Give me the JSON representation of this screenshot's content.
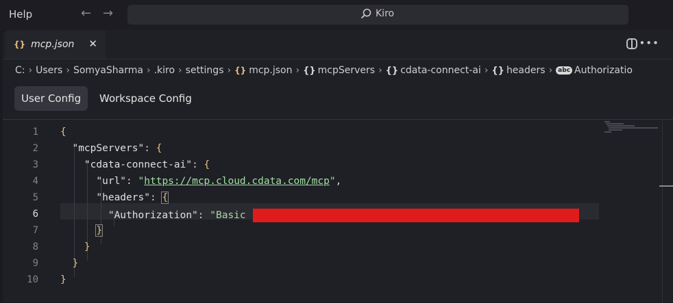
{
  "titlebar": {
    "menu_help": "Help",
    "back_icon": "arrow-left-icon",
    "forward_icon": "arrow-right-icon",
    "search_text": "Kiro"
  },
  "tabs": [
    {
      "label": "mcp.json",
      "icon": "{}",
      "close": "✕"
    }
  ],
  "breadcrumb": {
    "drive": "C:",
    "parts": [
      "Users",
      "SomyaSharma",
      ".kiro",
      "settings"
    ],
    "file": "mcp.json",
    "file_icon": "{}",
    "obj_icon": "{}",
    "symbols": [
      "mcpServers",
      "cdata-connect-ai",
      "headers"
    ],
    "string_icon": "abc",
    "last": "Authorizatio"
  },
  "config": {
    "user_config": "User Config",
    "workspace_config": "Workspace Config"
  },
  "editor": {
    "line_numbers": [
      "1",
      "2",
      "3",
      "4",
      "5",
      "6",
      "7",
      "8",
      "9",
      "10"
    ],
    "lines": {
      "l1_brace": "{",
      "l2_key": "\"mcpServers\"",
      "l2_rest": ": ",
      "l2_brace": "{",
      "l3_key": "\"cdata-connect-ai\"",
      "l3_rest": ": ",
      "l3_brace": "{",
      "l4_key": "\"url\"",
      "l4_colon": ": ",
      "l4_q1": "\"",
      "l4_url": "https://mcp.cloud.cdata.com/mcp",
      "l4_q2": "\"",
      "l4_comma": ",",
      "l5_key": "\"headers\"",
      "l5_rest": ": ",
      "l5_brace": "{",
      "l6_key": "\"Authorization\"",
      "l6_colon": ": ",
      "l6_val": "\"Basic ",
      "l7_brace": "}",
      "l8_brace": "}",
      "l9_brace": "}",
      "l10_brace": "}"
    },
    "redaction_color": "#e01b1b"
  }
}
